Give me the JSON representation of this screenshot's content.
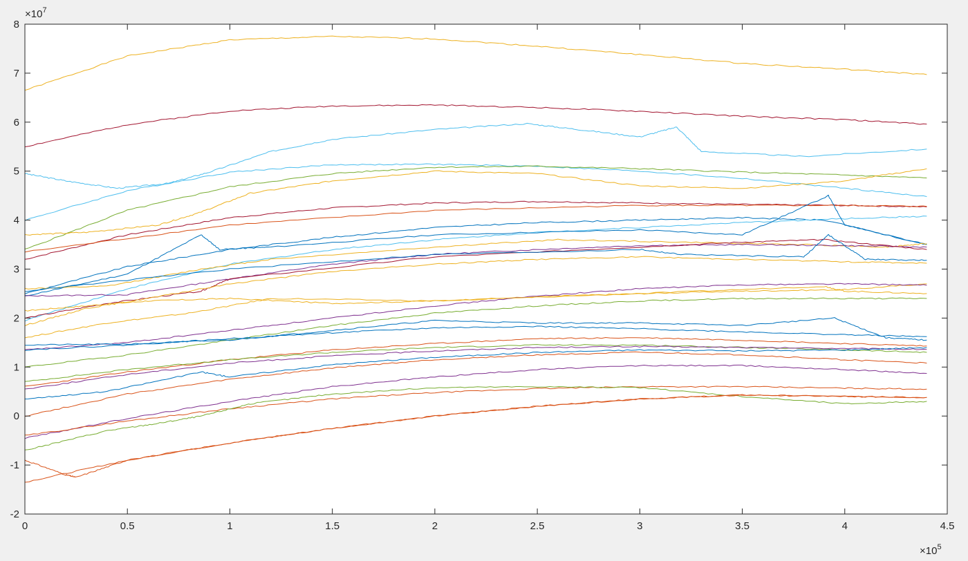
{
  "chart_data": {
    "type": "line",
    "title": "",
    "xlabel": "",
    "ylabel": "",
    "xlim": [
      0,
      450000
    ],
    "ylim": [
      -20000000,
      80000000
    ],
    "x_tick_labels": [
      "0",
      "0.5",
      "1",
      "1.5",
      "2",
      "2.5",
      "3",
      "3.5",
      "4",
      "4.5"
    ],
    "y_tick_labels": [
      "-2",
      "-1",
      "0",
      "1",
      "2",
      "3",
      "4",
      "5",
      "6",
      "7",
      "8"
    ],
    "x_exponent": {
      "base": "×10",
      "power": "5"
    },
    "y_exponent": {
      "base": "×10",
      "power": "7"
    },
    "grid": false,
    "legend": "none",
    "series": [
      {
        "color": "#EDB120",
        "x": [
          0,
          50000,
          100000,
          150000,
          200000,
          250000,
          300000,
          350000,
          400000,
          440000
        ],
        "y": [
          66500000,
          73500000,
          76800000,
          77500000,
          77000000,
          75500000,
          73800000,
          72000000,
          70800000,
          69700000
        ]
      },
      {
        "color": "#A2142F",
        "x": [
          0,
          50000,
          100000,
          150000,
          200000,
          250000,
          300000,
          350000,
          400000,
          440000
        ],
        "y": [
          55000000,
          59500000,
          62300000,
          63300000,
          63500000,
          63000000,
          62200000,
          61200000,
          60500000,
          59600000
        ]
      },
      {
        "color": "#4DBEEE",
        "x": [
          0,
          20000,
          45000,
          70000,
          90000,
          120000,
          150000,
          200000,
          245000,
          270000,
          300000,
          318000,
          330000,
          380000,
          440000
        ],
        "y": [
          49500000,
          48000000,
          46500000,
          47500000,
          49800000,
          54000000,
          56500000,
          58500000,
          59700000,
          58500000,
          57000000,
          59000000,
          54000000,
          53000000,
          54500000
        ]
      },
      {
        "color": "#4DBEEE",
        "x": [
          0,
          50000,
          100000,
          150000,
          200000,
          250000,
          300000,
          350000,
          400000,
          440000
        ],
        "y": [
          40000000,
          46000000,
          49800000,
          51300000,
          51400000,
          51000000,
          50000000,
          48500000,
          46500000,
          44800000
        ]
      },
      {
        "color": "#77AC30",
        "x": [
          0,
          50000,
          100000,
          150000,
          200000,
          250000,
          300000,
          350000,
          400000,
          440000
        ],
        "y": [
          34000000,
          42000000,
          46800000,
          49500000,
          50800000,
          51000000,
          50500000,
          49800000,
          49200000,
          48600000
        ]
      },
      {
        "color": "#EDB120",
        "x": [
          0,
          30000,
          65000,
          85000,
          110000,
          150000,
          200000,
          250000,
          300000,
          350000,
          400000,
          440000
        ],
        "y": [
          37000000,
          37500000,
          39000000,
          41500000,
          45500000,
          48000000,
          50000000,
          49500000,
          47000000,
          46500000,
          48000000,
          50500000
        ]
      },
      {
        "color": "#A2142F",
        "x": [
          0,
          50000,
          100000,
          150000,
          200000,
          250000,
          300000,
          350000,
          400000,
          440000
        ],
        "y": [
          32000000,
          37000000,
          40500000,
          42500000,
          43500000,
          43800000,
          43500000,
          43200000,
          43000000,
          42700000
        ]
      },
      {
        "color": "#D95319",
        "x": [
          0,
          100000,
          200000,
          300000,
          350000,
          400000,
          440000
        ],
        "y": [
          33500000,
          39000000,
          42000000,
          43000000,
          43000000,
          43000000,
          42800000
        ]
      },
      {
        "color": "#0072BD",
        "x": [
          0,
          50000,
          100000,
          150000,
          200000,
          250000,
          300000,
          350000,
          390000,
          440000
        ],
        "y": [
          25000000,
          30500000,
          34000000,
          36500000,
          38500000,
          39500000,
          40000000,
          40500000,
          40000000,
          35000000
        ]
      },
      {
        "color": "#4DBEEE",
        "x": [
          0,
          50000,
          100000,
          150000,
          200000,
          250000,
          300000,
          350000,
          400000,
          440000
        ],
        "y": [
          19500000,
          26000000,
          31000000,
          34000000,
          36000000,
          37500000,
          38500000,
          39500000,
          40300000,
          40800000
        ]
      },
      {
        "color": "#0072BD",
        "x": [
          0,
          50000,
          86000,
          95000,
          120000,
          200000,
          300000,
          350000,
          392000,
          400000,
          440000
        ],
        "y": [
          24500000,
          29000000,
          37000000,
          34000000,
          34500000,
          37000000,
          38000000,
          37000000,
          45000000,
          39000000,
          35000000
        ]
      },
      {
        "color": "#EDB120",
        "x": [
          0,
          40000,
          86000,
          120000,
          200000,
          260000,
          320000,
          380000,
          420000,
          440000
        ],
        "y": [
          26000000,
          26500000,
          30000000,
          32000000,
          34500000,
          36000000,
          35500000,
          35000000,
          34500000,
          35200000
        ]
      },
      {
        "color": "#7E2F8E",
        "x": [
          0,
          50000,
          100000,
          150000,
          200000,
          250000,
          300000,
          350000,
          400000,
          440000
        ],
        "y": [
          24500000,
          24800000,
          28000000,
          31000000,
          33000000,
          34000000,
          34800000,
          35000000,
          34800000,
          34500000
        ]
      },
      {
        "color": "#A2142F",
        "x": [
          0,
          40000,
          86000,
          100000,
          200000,
          300000,
          350000,
          390000,
          440000
        ],
        "y": [
          20000000,
          23000000,
          25500000,
          28000000,
          32500000,
          34500000,
          35500000,
          36000000,
          34000000
        ]
      },
      {
        "color": "#EDB120",
        "x": [
          0,
          30000,
          60000,
          100000,
          150000,
          200000,
          250000,
          300000,
          350000,
          400000,
          440000
        ],
        "y": [
          18500000,
          22000000,
          24000000,
          27000000,
          29500000,
          31000000,
          32000000,
          32500000,
          32000000,
          31500000,
          31200000
        ]
      },
      {
        "color": "#0072BD",
        "x": [
          0,
          100000,
          200000,
          300000,
          320000,
          380000,
          392000,
          410000,
          440000
        ],
        "y": [
          25500000,
          30000000,
          33000000,
          34000000,
          33000000,
          32500000,
          37000000,
          32000000,
          31800000
        ]
      },
      {
        "color": "#EDB120",
        "x": [
          0,
          30000,
          60000,
          100000,
          150000,
          200000,
          260000,
          300000,
          350000,
          400000,
          440000
        ],
        "y": [
          21500000,
          22500000,
          23500000,
          24000000,
          23000000,
          23500000,
          24500000,
          25000000,
          25500000,
          25800000,
          27000000
        ]
      },
      {
        "color": "#7E2F8E",
        "x": [
          0,
          50000,
          100000,
          150000,
          200000,
          250000,
          300000,
          350000,
          400000,
          440000
        ],
        "y": [
          13500000,
          15000000,
          17500000,
          20000000,
          22500000,
          24500000,
          26000000,
          26800000,
          27000000,
          26700000
        ]
      },
      {
        "color": "#77AC30",
        "x": [
          0,
          50000,
          100000,
          150000,
          200000,
          250000,
          300000,
          350000,
          400000,
          440000
        ],
        "y": [
          10000000,
          12500000,
          15500000,
          18500000,
          21000000,
          22500000,
          23500000,
          24000000,
          24000000,
          24000000
        ]
      },
      {
        "color": "#EDB120",
        "x": [
          0,
          40000,
          80000,
          120000,
          200000,
          300000,
          390000,
          400000,
          440000
        ],
        "y": [
          16000000,
          19000000,
          21000000,
          24000000,
          23500000,
          25000000,
          26500000,
          25500000,
          25000000
        ]
      },
      {
        "color": "#0072BD",
        "x": [
          0,
          50000,
          100000,
          150000,
          200000,
          250000,
          300000,
          350000,
          395000,
          420000,
          440000
        ],
        "y": [
          14500000,
          14700000,
          15500000,
          17500000,
          19500000,
          19000000,
          19000000,
          18500000,
          20000000,
          16000000,
          15500000
        ]
      },
      {
        "color": "#0072BD",
        "x": [
          0,
          50000,
          100000,
          150000,
          200000,
          250000,
          300000,
          350000,
          400000,
          440000
        ],
        "y": [
          13500000,
          14500000,
          15800000,
          17000000,
          18000000,
          18300000,
          17800000,
          17200000,
          16600000,
          16200000
        ]
      },
      {
        "color": "#D95319",
        "x": [
          0,
          50000,
          100000,
          150000,
          200000,
          250000,
          300000,
          350000,
          400000,
          440000
        ],
        "y": [
          6000000,
          9000000,
          11500000,
          13500000,
          14800000,
          15800000,
          16000000,
          15500000,
          14800000,
          14300000
        ]
      },
      {
        "color": "#77AC30",
        "x": [
          0,
          50000,
          100000,
          150000,
          200000,
          250000,
          300000,
          350000,
          400000,
          440000
        ],
        "y": [
          7000000,
          9500000,
          11500000,
          13000000,
          14000000,
          14500000,
          14500000,
          14000000,
          13500000,
          13000000
        ]
      },
      {
        "color": "#7E2F8E",
        "x": [
          0,
          50000,
          100000,
          150000,
          200000,
          250000,
          300000,
          350000,
          400000,
          440000
        ],
        "y": [
          5500000,
          8500000,
          10800000,
          12300000,
          13300000,
          14000000,
          14200000,
          14000000,
          13800000,
          13600000
        ]
      },
      {
        "color": "#0072BD",
        "x": [
          0,
          40000,
          86000,
          100000,
          150000,
          200000,
          250000,
          300000,
          350000,
          400000,
          440000
        ],
        "y": [
          3500000,
          5000000,
          9000000,
          8000000,
          10500000,
          12000000,
          13000000,
          13500000,
          13300000,
          13500000,
          14000000
        ]
      },
      {
        "color": "#D95319",
        "x": [
          0,
          50000,
          100000,
          150000,
          200000,
          250000,
          300000,
          350000,
          400000,
          440000
        ],
        "y": [
          0,
          4500000,
          7500000,
          9800000,
          11500000,
          12500000,
          13000000,
          12500000,
          11500000,
          10800000
        ]
      },
      {
        "color": "#7E2F8E",
        "x": [
          0,
          50000,
          100000,
          150000,
          200000,
          250000,
          300000,
          350000,
          400000,
          440000
        ],
        "y": [
          -4500000,
          -500000,
          3000000,
          6000000,
          8000000,
          9500000,
          10300000,
          10300000,
          9500000,
          8700000
        ]
      },
      {
        "color": "#D95319",
        "x": [
          0,
          50000,
          100000,
          150000,
          200000,
          250000,
          300000,
          350000,
          400000,
          440000
        ],
        "y": [
          -4000000,
          -1000000,
          1500000,
          3500000,
          4800000,
          5600000,
          6000000,
          6000000,
          5700000,
          5500000
        ]
      },
      {
        "color": "#77AC30",
        "x": [
          0,
          40000,
          65000,
          86000,
          110000,
          150000,
          200000,
          250000,
          300000,
          350000,
          400000,
          440000
        ],
        "y": [
          -7000000,
          -3000000,
          -1500000,
          0,
          2500000,
          4500000,
          5800000,
          6000000,
          5800000,
          4000000,
          2500000,
          3000000
        ]
      },
      {
        "color": "#D95319",
        "x": [
          0,
          20000,
          25000,
          50000,
          100000,
          150000,
          200000,
          250000,
          300000,
          350000,
          400000,
          440000
        ],
        "y": [
          -9000000,
          -12000000,
          -12500000,
          -9000000,
          -5500000,
          -2500000,
          0,
          2000000,
          3500000,
          4300000,
          4000000,
          3800000
        ]
      },
      {
        "color": "#D95319",
        "x": [
          0,
          50000,
          100000,
          150000,
          200000,
          250000,
          300000,
          350000,
          400000,
          440000
        ],
        "y": [
          -13500000,
          -9000000,
          -5500000,
          -2500000,
          0,
          2000000,
          3500000,
          4300000,
          4000000,
          3800000
        ]
      }
    ]
  }
}
